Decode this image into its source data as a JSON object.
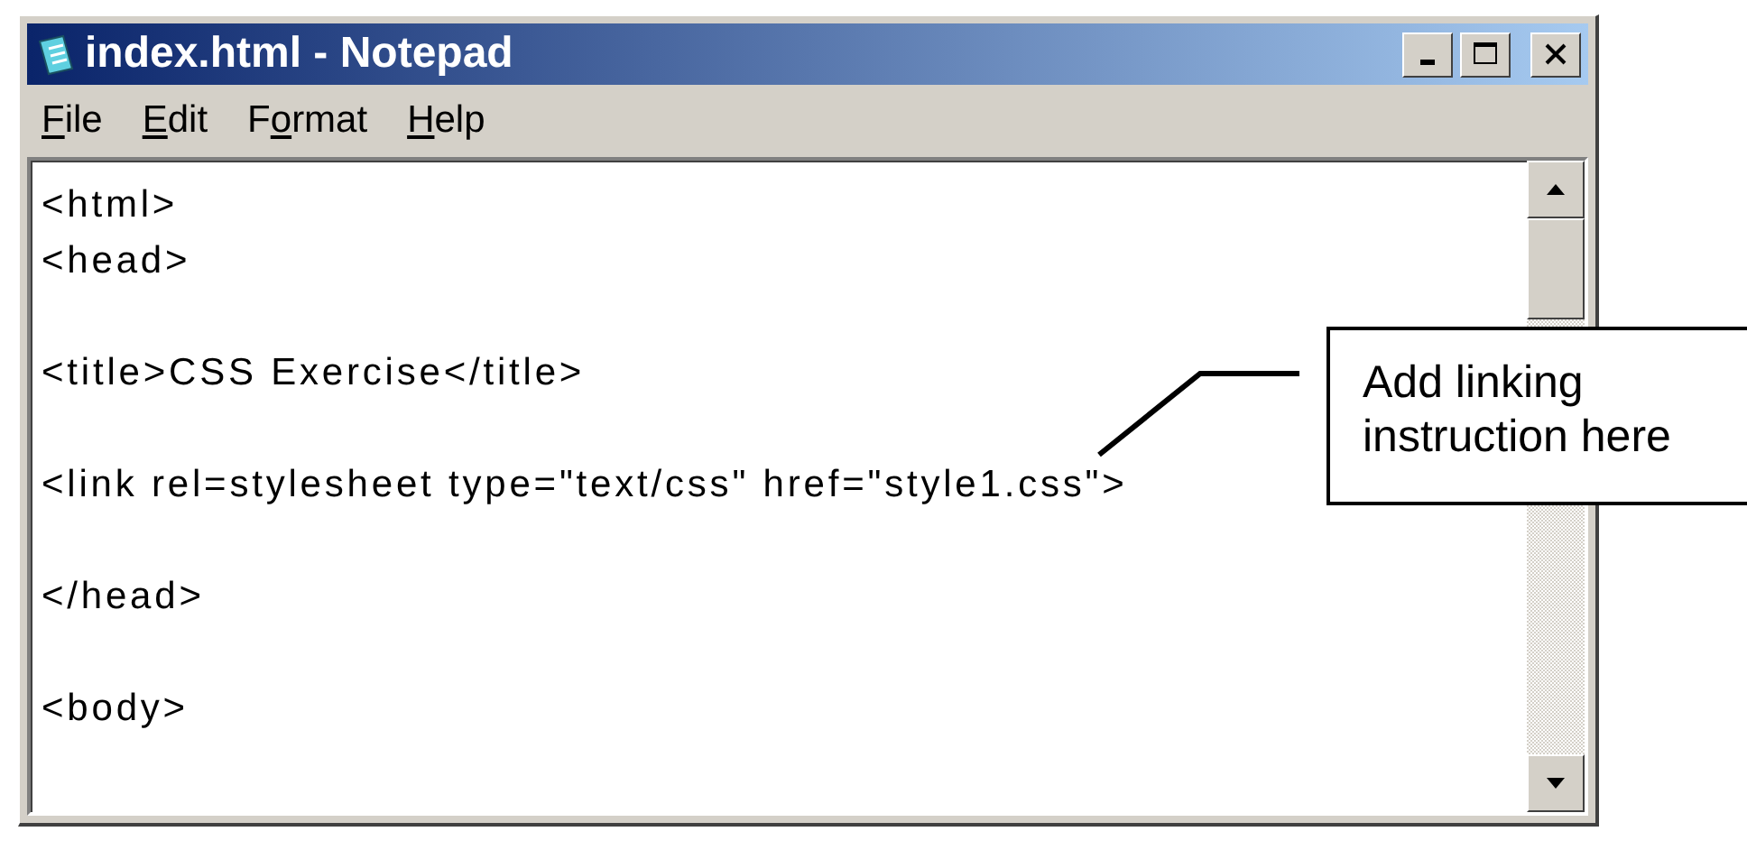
{
  "window": {
    "title": "index.html - Notepad"
  },
  "menu": [
    {
      "accelerator": "F",
      "after": "ile"
    },
    {
      "accelerator": "E",
      "after": "dit"
    },
    {
      "before": "F",
      "accelerator": "o",
      "after": "rmat"
    },
    {
      "accelerator": "H",
      "after": "elp"
    }
  ],
  "editor": {
    "lines": [
      {
        "kind": "code",
        "text": "<html>"
      },
      {
        "kind": "code",
        "text": "<head>"
      },
      {
        "kind": "blank"
      },
      {
        "kind": "code",
        "text": "<title>CSS Exercise</title>"
      },
      {
        "kind": "blank"
      },
      {
        "kind": "code",
        "text": "<link rel=stylesheet type=\"text/css\" href=\"style1.css\">"
      },
      {
        "kind": "blank"
      },
      {
        "kind": "code",
        "text": "</head>"
      },
      {
        "kind": "blank"
      },
      {
        "kind": "code",
        "text": "<body>"
      }
    ]
  },
  "callout": {
    "text": "Add linking instruction here"
  }
}
